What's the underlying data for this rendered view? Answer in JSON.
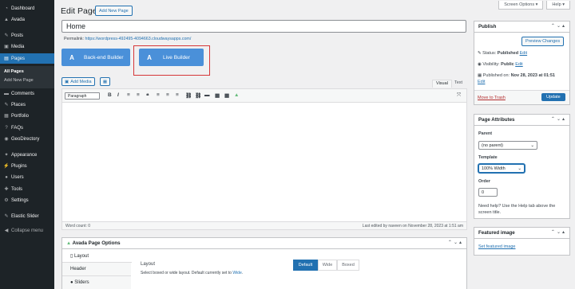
{
  "sidebar": {
    "items": [
      {
        "label": "Dashboard",
        "icon": "dashboard-icon",
        "glyph": "◔"
      },
      {
        "label": "Avada",
        "icon": "avada-icon",
        "glyph": "▲"
      },
      {
        "label": "Posts",
        "icon": "pin-icon",
        "glyph": "✎"
      },
      {
        "label": "Media",
        "icon": "media-icon",
        "glyph": "▣"
      },
      {
        "label": "Pages",
        "icon": "pages-icon",
        "glyph": "▤"
      },
      {
        "label": "Comments",
        "icon": "comments-icon",
        "glyph": "▬"
      },
      {
        "label": "Places",
        "icon": "places-icon",
        "glyph": "✎"
      },
      {
        "label": "Portfolio",
        "icon": "portfolio-icon",
        "glyph": "▦"
      },
      {
        "label": "FAQs",
        "icon": "faq-icon",
        "glyph": "?"
      },
      {
        "label": "GeoDirectory",
        "icon": "geo-icon",
        "glyph": "◉"
      },
      {
        "label": "Appearance",
        "icon": "appearance-icon",
        "glyph": "✦"
      },
      {
        "label": "Plugins",
        "icon": "plugins-icon",
        "glyph": "⚡"
      },
      {
        "label": "Users",
        "icon": "users-icon",
        "glyph": "●"
      },
      {
        "label": "Tools",
        "icon": "tools-icon",
        "glyph": "✚"
      },
      {
        "label": "Settings",
        "icon": "settings-icon",
        "glyph": "⚙"
      },
      {
        "label": "Elastic Slider",
        "icon": "slider-icon",
        "glyph": "✎"
      },
      {
        "label": "Collapse menu",
        "icon": "collapse-icon",
        "glyph": "◀"
      }
    ],
    "sub": {
      "all_pages": "All Pages",
      "add_new": "Add New Page"
    }
  },
  "top": {
    "screen_options": "Screen Options ▾",
    "help": "Help ▾"
  },
  "header": {
    "title": "Edit Page",
    "add_new": "Add New Page"
  },
  "page_title_value": "Home",
  "permalink": {
    "label": "Permalink:",
    "url": "https://wordpress-492495-4094663.cloudwaysapps.com/"
  },
  "builders": {
    "backend": "Back-end Builder",
    "live": "Live Builder",
    "logo": "A"
  },
  "editor": {
    "add_media": "Add Media",
    "visual_tab": "Visual",
    "text_tab": "Text",
    "format_select": "Paragraph",
    "toolbar": [
      "B",
      "I",
      "≡",
      "≡",
      "❝",
      "≡",
      "≡",
      "≡",
      "⛓",
      "⛓",
      "▬",
      "▦",
      "▦",
      "▲"
    ],
    "word_count": "Word count: 0",
    "last_edited": "Last edited by naveen on November 28, 2023 at 1:51 am"
  },
  "publish": {
    "title": "Publish",
    "preview": "Preview Changes",
    "status_label": "Status:",
    "status_value": "Published",
    "status_edit": "Edit",
    "visibility_label": "Visibility:",
    "visibility_value": "Public",
    "visibility_edit": "Edit",
    "published_label": "Published on:",
    "published_value": "Nov 28, 2023 at 01:51",
    "published_edit": "Edit",
    "trash": "Move to Trash",
    "update": "Update"
  },
  "attributes": {
    "title": "Page Attributes",
    "parent_label": "Parent",
    "parent_value": "(no parent)",
    "template_label": "Template",
    "template_value": "100% Width",
    "order_label": "Order",
    "order_value": "0",
    "help_text": "Need help? Use the Help tab above the screen title."
  },
  "featured": {
    "title": "Featured image",
    "link": "Set featured image"
  },
  "avada_options": {
    "title": "Avada Page Options",
    "tabs": [
      "Layout",
      "Header",
      "Sliders"
    ],
    "layout_heading": "Layout",
    "layout_desc": "Select boxed or wide layout. Default currently set to",
    "layout_desc_link": "Wide",
    "segments": [
      "Default",
      "Wide",
      "Boxed"
    ]
  },
  "colors": {
    "accent": "#2271b1",
    "sidebar": "#1d2327",
    "builder": "#4a90d9",
    "highlight": "#d63638"
  }
}
